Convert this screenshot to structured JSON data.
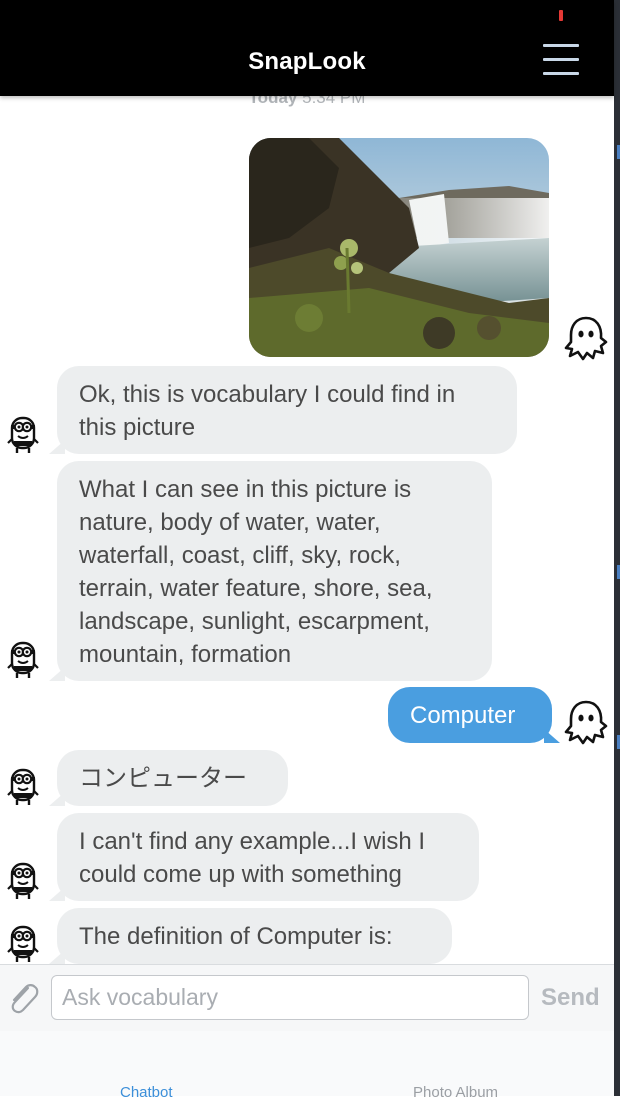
{
  "header": {
    "title": "SnapLook",
    "menu_icon": "hamburger-menu-icon"
  },
  "chat": {
    "timestamp_day": "Today",
    "timestamp_time": "5:34 PM",
    "messages": [
      {
        "sender": "user",
        "type": "image",
        "description_icon": "waterfall-photo"
      },
      {
        "sender": "bot",
        "text": "Ok, this is vocabulary I could find in this picture"
      },
      {
        "sender": "bot",
        "text": "What I can see in this picture is nature, body of water, water, waterfall, coast, cliff, sky, rock, terrain, water feature, shore, sea, landscape, sunlight, escarpment, mountain, formation"
      },
      {
        "sender": "user",
        "text": "Computer"
      },
      {
        "sender": "bot",
        "text": "コンピューター"
      },
      {
        "sender": "bot",
        "text": "I can't find any example...I wish I could come up with something"
      },
      {
        "sender": "bot",
        "text": "The definition of Computer is:"
      }
    ],
    "bot_avatar_icon": "minion-robot-avatar-icon",
    "user_avatar_icon": "ghost-avatar-icon"
  },
  "composer": {
    "attach_icon": "paperclip-icon",
    "placeholder": "Ask vocabulary",
    "value": "",
    "send_label": "Send"
  },
  "tabs": [
    {
      "label": "Chatbot",
      "active": true
    },
    {
      "label": "Photo Album",
      "active": false
    }
  ],
  "colors": {
    "header_bg": "#000000",
    "bot_bubble": "#eceeef",
    "user_bubble": "#4a9ee0",
    "active_tab": "#3c8fd9"
  }
}
